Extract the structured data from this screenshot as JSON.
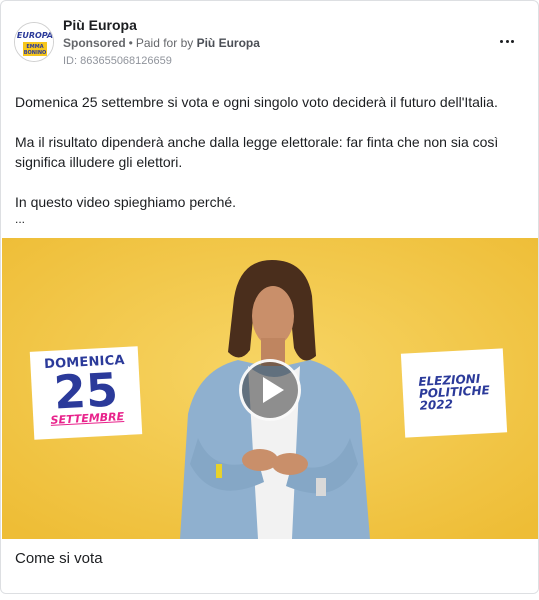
{
  "header": {
    "page_name": "Più Europa",
    "sponsored": "Sponsored",
    "separator": "•",
    "paid_for_prefix": "Paid for by",
    "payer": "Più Europa",
    "ad_id": "ID: 863655068126659",
    "avatar_logo_text": [
      "EUROPA",
      "EMMA",
      "BONINO"
    ]
  },
  "post": {
    "paragraph_1": "Domenica 25 settembre si vota e ogni singolo voto deciderà il futuro dell'Italia.",
    "paragraph_2_line_1": "Ma il risultato dipenderà anche dalla legge elettorale: far finta che non sia così",
    "paragraph_2_line_2": "significa illudere gli elettori.",
    "paragraph_3": "In questo video spieghiamo perché.",
    "ellipsis": "..."
  },
  "video": {
    "date_card": {
      "line1": "DOMENICA",
      "line2": "25",
      "line3": "SETTEMBRE"
    },
    "election_card": {
      "line1": "ELEZIONI",
      "line2": "POLITICHE",
      "line3": "2022"
    },
    "background_color": "#f4c842"
  },
  "caption": {
    "title": "Come si vota"
  },
  "colors": {
    "brand_blue": "#2b3a9a",
    "brand_pink": "#e8228b",
    "brand_yellow": "#f6c61c"
  }
}
